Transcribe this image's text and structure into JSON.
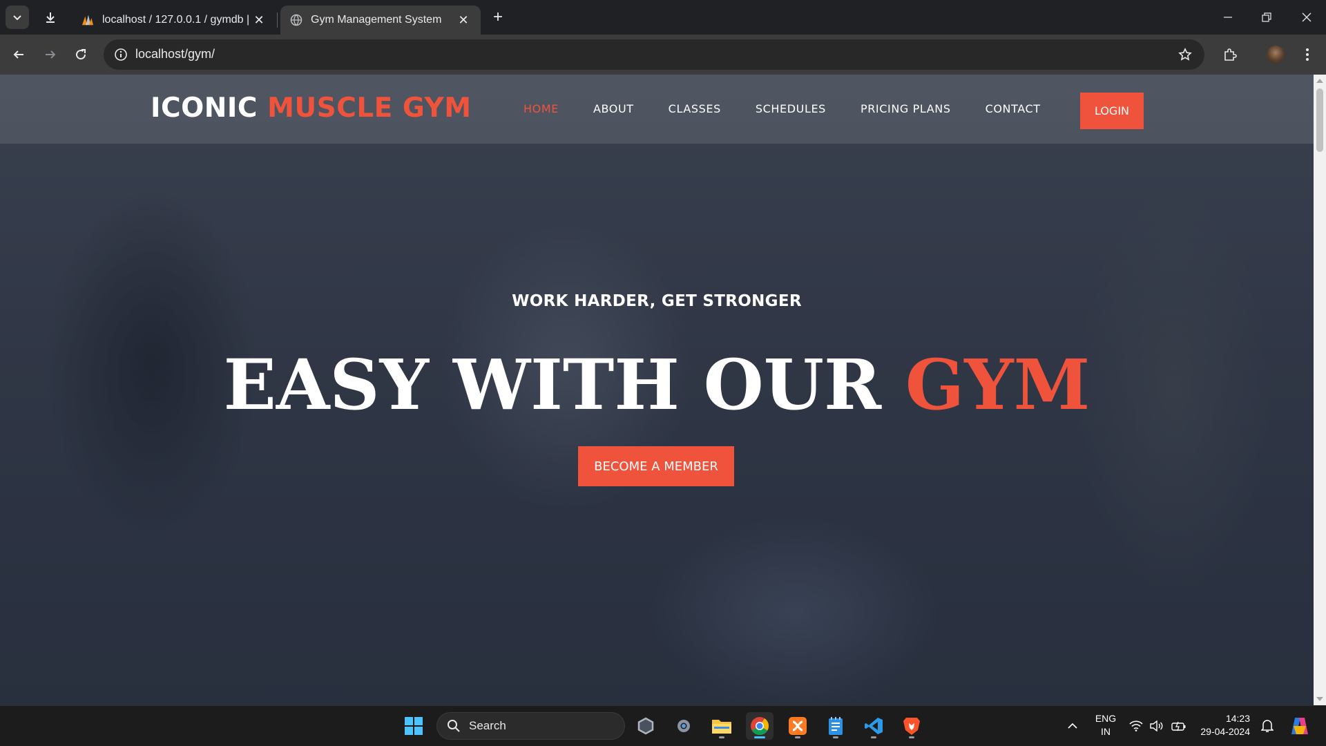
{
  "browser": {
    "tabs": [
      {
        "title": "localhost / 127.0.0.1 / gymdb | ",
        "favicon": "phpmyadmin-icon",
        "active": false
      },
      {
        "title": "Gym Management System",
        "favicon": "globe-icon",
        "active": true
      }
    ],
    "address": "localhost/gym/"
  },
  "site": {
    "logo_white": "ICONIC",
    "logo_red": "MUSCLE GYM",
    "nav": [
      {
        "label": "HOME",
        "active": true
      },
      {
        "label": "ABOUT",
        "active": false
      },
      {
        "label": "CLASSES",
        "active": false
      },
      {
        "label": "SCHEDULES",
        "active": false
      },
      {
        "label": "PRICING PLANS",
        "active": false
      },
      {
        "label": "CONTACT",
        "active": false
      }
    ],
    "login_label": "LOGIN",
    "tagline": "WORK HARDER, GET STRONGER",
    "hero_white": "EASY WITH OUR",
    "hero_red": "GYM",
    "cta_label": "BECOME A MEMBER",
    "accent": "#f0533b"
  },
  "taskbar": {
    "search_label": "Search",
    "lang_line1": "ENG",
    "lang_line2": "IN",
    "time": "14:23",
    "date": "29-04-2024"
  }
}
